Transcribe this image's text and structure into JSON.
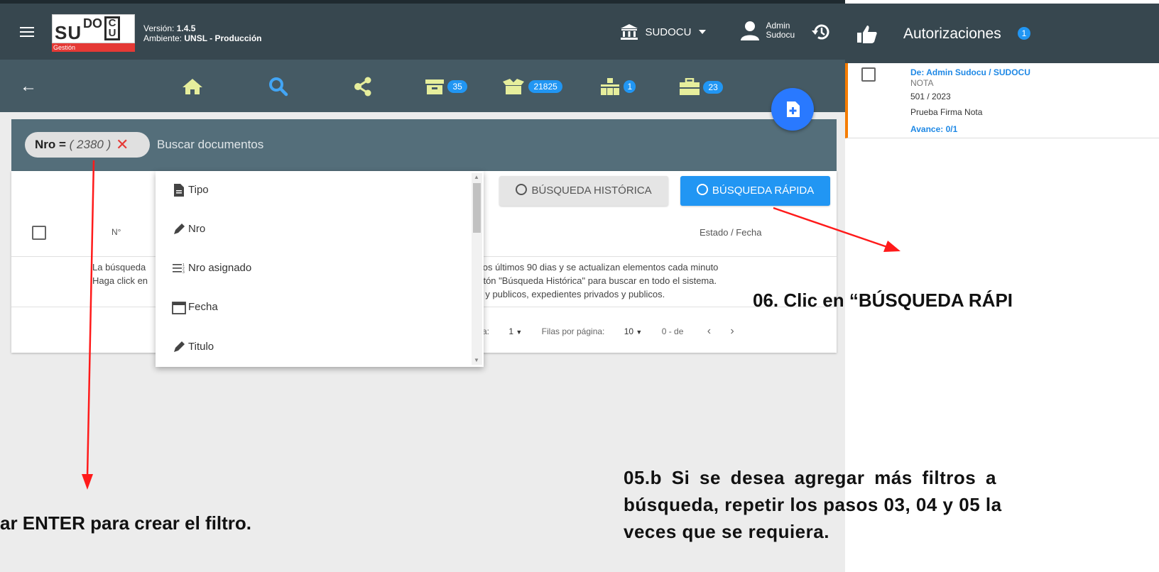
{
  "header": {
    "version_label": "Versión: ",
    "version": "1.4.5",
    "env_label": "Ambiente: ",
    "env": "UNSL - Producción",
    "logo_gestion": "Gestión",
    "org_menu": "SUDOCU",
    "user_line1": "Admin",
    "user_line2": "Sudocu"
  },
  "nav": {
    "badge_archive": "35",
    "badge_inbox": "21825",
    "badge_org": "1",
    "badge_folder": "23"
  },
  "search": {
    "chip_field": "Nro = ",
    "chip_value": "( 2380 )",
    "placeholder": "Buscar documentos",
    "btn_historic": "BÚSQUEDA HISTÓRICA",
    "btn_quick": "BÚSQUEDA RÁPIDA"
  },
  "table": {
    "col_nro": "N°",
    "col_estado": "Estado / Fecha",
    "info_l1": "La búsqueda",
    "info_l2": "Haga click en",
    "info_r1": "n los últimos 90 dias y se actualizan elementos cada minuto",
    "info_r2": "botón \"Búsqueda Histórica\" para buscar en todo el sistema.",
    "info_r3": "os y publicos, expedientes privados y publicos.",
    "pag_prefix": "a:",
    "pag_page": "1",
    "rows_label": "Filas por página:",
    "rows_value": "10",
    "range": "0 - de"
  },
  "dropdown": {
    "items": [
      "Tipo",
      "Nro",
      "Nro asignado",
      "Fecha",
      "Titulo"
    ]
  },
  "panel": {
    "title": "Autorizaciones",
    "badge": "1",
    "item_from": "De: Admin Sudocu / SUDOCU",
    "item_type": "NOTA",
    "item_number": "501 / 2023",
    "item_title": "Prueba Firma Nota",
    "item_progress": "Avance: 0/1"
  },
  "annotations": {
    "step06": "06. Clic en “BÚSQUEDA RÁPI",
    "step05b_l1": "05.b Si se desea agregar más filtros a",
    "step05b_l2": "búsqueda, repetir los pasos 03, 04 y 05 la",
    "step05b_l3": "veces que se requiera.",
    "enter": "ar ENTER para crear el filtro."
  },
  "colors": {
    "topbar": "#37474f",
    "subbar": "#455a64",
    "accent_yellow": "#e6ee9c",
    "accent_blue": "#2196f3",
    "red_arrow": "#ff1a1a"
  }
}
